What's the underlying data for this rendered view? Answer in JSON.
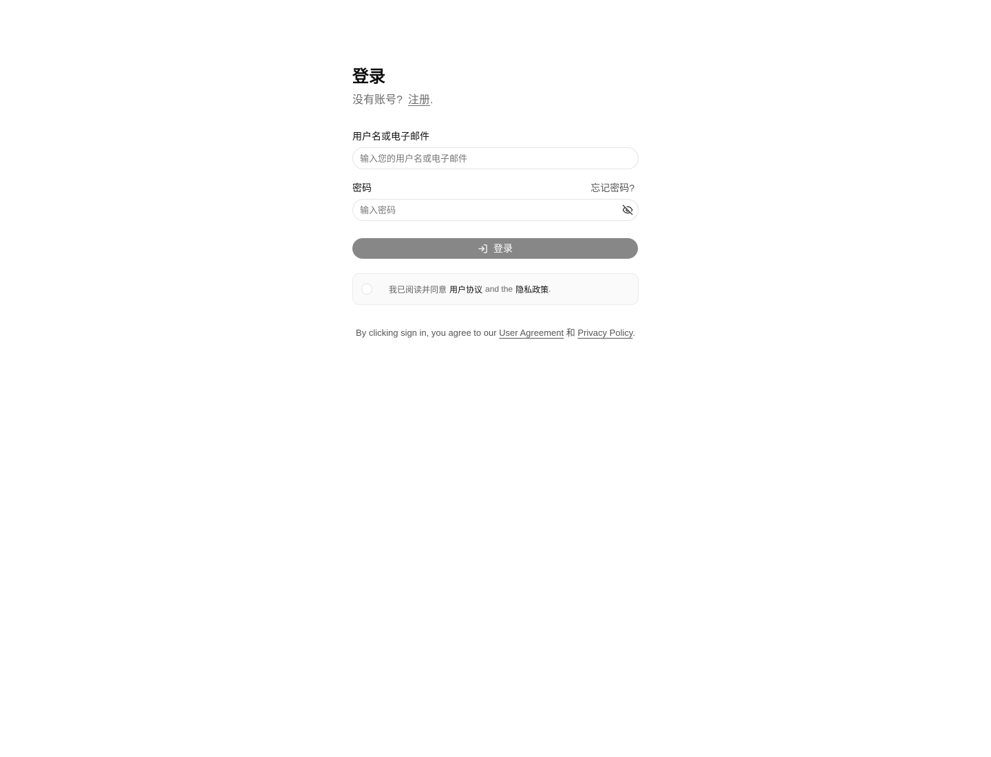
{
  "header": {
    "title": "登录",
    "no_account_text": "没有账号?",
    "register_link": "注册",
    "register_suffix": "."
  },
  "username": {
    "label": "用户名或电子邮件",
    "placeholder": "输入您的用户名或电子邮件",
    "value": ""
  },
  "password": {
    "label": "密码",
    "forgot_link": "忘记密码?",
    "placeholder": "输入密码",
    "value": "",
    "visibility_icon": "eye-off-icon"
  },
  "login_button": {
    "label": "登录",
    "icon": "log-in-icon",
    "color": "#878787"
  },
  "agreement": {
    "checked": false,
    "prefix": "我已阅读并同意",
    "user_agreement": "用户协议",
    "conjunction": "and the",
    "privacy_policy": "隐私政策",
    "suffix": "."
  },
  "footer": {
    "prefix": "By clicking sign in, you agree to our",
    "user_agreement": "User Agreement",
    "conjunction": "和",
    "privacy_policy": "Privacy Policy",
    "suffix": "."
  }
}
